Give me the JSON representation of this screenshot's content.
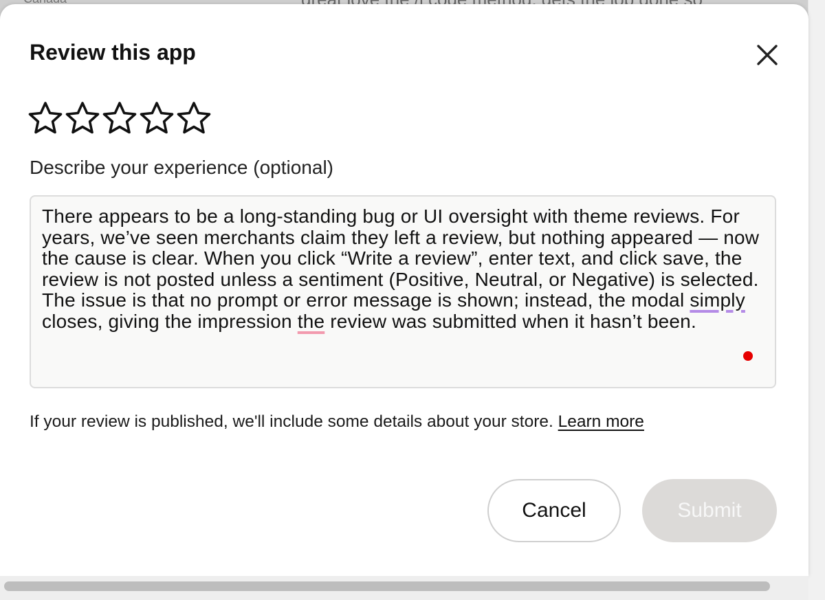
{
  "background": {
    "left_text": "Canada",
    "right_text": "great love the /i code method, gets the job done so"
  },
  "modal": {
    "title": "Review this app",
    "close_icon": "close-icon",
    "rating": {
      "max_stars": 5,
      "selected": 0,
      "star_icon": "star-outline-icon"
    },
    "field_label": "Describe your experience (optional)",
    "review_text": {
      "part1": "There appears to be a long-standing bug or UI oversight with theme reviews. For years, we’ve seen merchants claim they left a review, but nothing appeared — now the cause is clear. When you click “Write a review”, enter text, and click save, the review is not posted unless a sentiment (Positive, Neutral, or Negative) is selected. The issue is that no prompt or error message is shown; instead, the modal ",
      "flagged1": "simply",
      "part2": " closes, giving the impression ",
      "flagged2": "the",
      "part3": " review was submitted when it hasn’t been."
    },
    "notice_text": "If your review is published, we'll include some details about your store. ",
    "learn_more_label": "Learn more",
    "cancel_label": "Cancel",
    "submit_label": "Submit",
    "colors": {
      "spellcheck_purple": "#b48be6",
      "spellcheck_pink": "#f29aae",
      "submit_disabled_bg": "#dcdad8",
      "cursor_dot": "#e60000"
    }
  }
}
